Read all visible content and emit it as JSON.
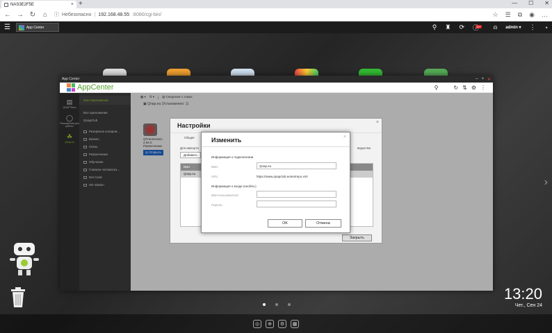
{
  "browser": {
    "tab_title": "NAS3E2F5E",
    "insecure_label": "Небезопасно",
    "url_host": "192.168.48.55",
    "url_rest": ":8080/cgi-bin/"
  },
  "qts": {
    "app_tab": "App Center",
    "notif_count": "10+",
    "user": "admin ▾"
  },
  "appcenter": {
    "window_title": "App Center",
    "title": "AppCenter",
    "left_icons": [
      {
        "label": "QNAP Store"
      },
      {
        "label": "Расширения для работы"
      },
      {
        "label": "Qnap.eu"
      }
    ],
    "menu_selected": "Мои приложения",
    "menu_items": [
      "Все приложения",
      "QnapClub"
    ],
    "menu_sub": [
      "Резервное копиров...",
      "Бизнес",
      "Связь",
      "Развлечения",
      "Обучение",
      "Главная Автоматиз...",
      "Dev tools",
      "HD Station"
    ],
    "toolbar_text": "Сведения о томах",
    "repo_text": "Qnap.eu (Установлено: 1)",
    "app_name": "QTransmissio",
    "app_version": "2.94.0",
    "app_category": "Развлечение",
    "open_button": "Открыть"
  },
  "settings": {
    "title": "Настройки",
    "tab": "Общие",
    "desc": "Для импорта",
    "desc_right": "ведастви",
    "add_button": "Добавить",
    "col_name": "Имя",
    "row_name": "Qnap.eu",
    "close_button": "Закрыть"
  },
  "edit": {
    "title": "Изменить",
    "section_conn": "Информация о подключении",
    "name_label": "Имя:",
    "name_value": "Qnap.eu",
    "url_label": "URL:",
    "url_value": "https://www.qnapclub.eu/en/repo.xml",
    "section_login": "Информация о входе (необяз.)",
    "user_label": "Имя пользователя:",
    "pass_label": "Пароль:",
    "ok_button": "OK",
    "cancel_button": "Отмена"
  },
  "clock": {
    "time": "13:20",
    "date": "Чет., Сен 24"
  },
  "colors": {
    "accent": "#5aa030",
    "primary_button": "#1f63c6"
  }
}
